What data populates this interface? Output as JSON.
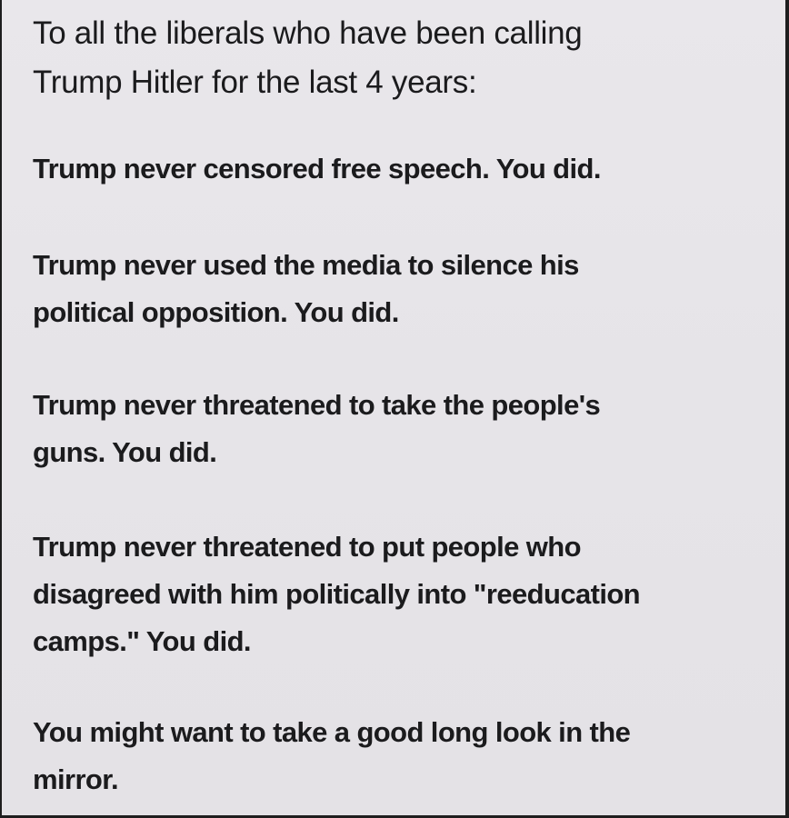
{
  "heading": "To all the liberals who have been calling\nTrump Hitler for the last 4 years:",
  "paragraphs": [
    "Trump never censored free speech. You did.",
    "Trump never used the media to silence his\npolitical opposition. You did.",
    "Trump never threatened to take the people's\nguns. You did.",
    "Trump never threatened to put people who\ndisagreed with him politically into \"reeducation\ncamps.\" You did.",
    "You might want to take a good long look in the\nmirror."
  ]
}
